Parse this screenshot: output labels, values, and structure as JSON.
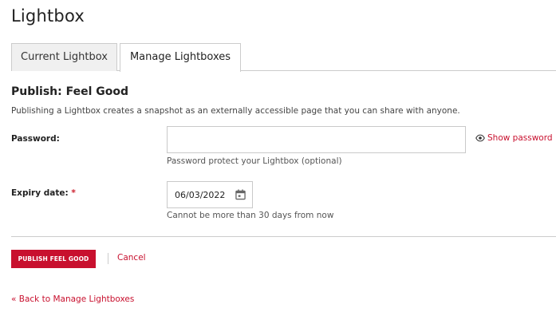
{
  "page": {
    "title": "Lightbox"
  },
  "tabs": [
    {
      "label": "Current Lightbox",
      "active": false
    },
    {
      "label": "Manage Lightboxes",
      "active": true
    }
  ],
  "publish": {
    "title": "Publish: Feel Good",
    "description": "Publishing a Lightbox creates a snapshot as an externally accessible page that you can share with anyone."
  },
  "password": {
    "label": "Password:",
    "value": "",
    "placeholder": "",
    "help": "Password protect your Lightbox (optional)",
    "show_label": "Show password",
    "show_icon": "eye-icon"
  },
  "expiry": {
    "label": "Expiry date:",
    "required_marker": "*",
    "value": "06/03/2022",
    "icon": "calendar-icon",
    "help": "Cannot be more than 30 days from now"
  },
  "actions": {
    "publish_label": "PUBLISH FEEL GOOD",
    "cancel_label": "Cancel",
    "back_label": "« Back to Manage Lightboxes"
  },
  "colors": {
    "accent": "#c8102e",
    "border": "#cccccc",
    "inactive_tab_bg": "#f0f0f0"
  }
}
